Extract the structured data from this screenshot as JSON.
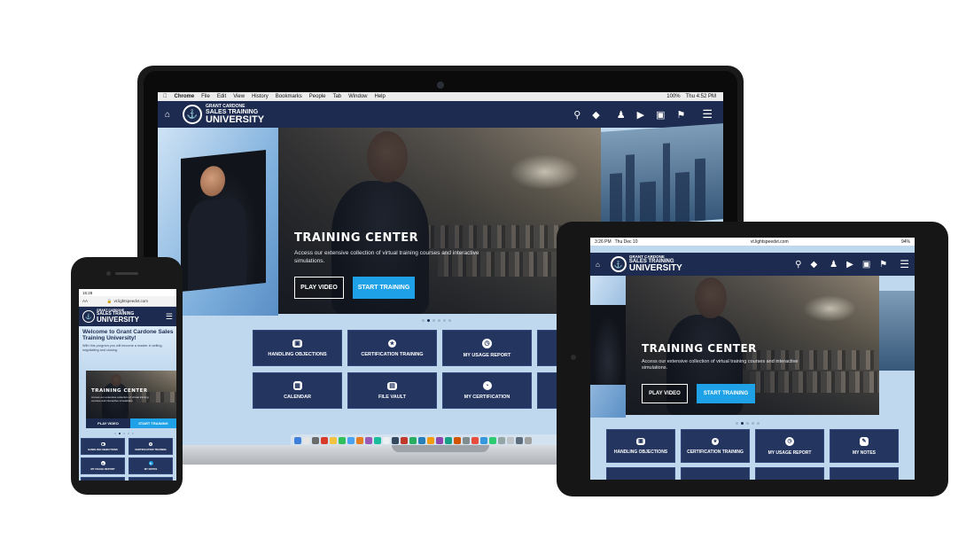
{
  "colors": {
    "navy": "#1c2b4f",
    "tile": "#24355f",
    "accent_blue": "#1ea1e6"
  },
  "laptop": {
    "menubar": {
      "items": [
        "Chrome",
        "File",
        "Edit",
        "View",
        "History",
        "Bookmarks",
        "People",
        "Tab",
        "Window",
        "Help"
      ],
      "battery": "100%",
      "clock": "Thu 4:52 PM"
    },
    "logo": {
      "line1": "Grant Cardone",
      "line2": "Sales Training",
      "line3": "University"
    },
    "nav_icons": [
      "home-icon",
      "search-icon",
      "diamond-icon",
      "user-icon",
      "megaphone-icon",
      "briefcase-icon",
      "flag-icon",
      "menu-icon"
    ],
    "hero": {
      "title": "TRAINING CENTER",
      "description": "Access our extensive collection of virtual training courses and interactive simulations.",
      "play_label": "PLAY VIDEO",
      "start_label": "START TRAINING"
    },
    "tiles": [
      {
        "label": "HANDLING OBJECTIONS",
        "icon": "briefcase-icon"
      },
      {
        "label": "CERTIFICATION TRAINING",
        "icon": "award-icon"
      },
      {
        "label": "MY USAGE REPORT",
        "icon": "gauge-icon"
      },
      {
        "label": "CALENDAR",
        "icon": "calendar-icon"
      },
      {
        "label": "FILE VAULT",
        "icon": "vault-icon"
      },
      {
        "label": "MY CERTIFICATION",
        "icon": "pie-chart-icon"
      }
    ]
  },
  "tablet": {
    "status": {
      "time": "3:26 PM",
      "date": "Thu Dec 10",
      "url": "vt.lightspeedvt.com",
      "battery": "94%"
    },
    "hero": {
      "title": "TRAINING CENTER",
      "description": "Access our extensive collection of virtual training courses and interactive simulations.",
      "play_label": "PLAY VIDEO",
      "start_label": "START TRAINING"
    },
    "tiles": [
      {
        "label": "HANDLING OBJECTIONS",
        "icon": "briefcase-icon"
      },
      {
        "label": "CERTIFICATION TRAINING",
        "icon": "award-icon"
      },
      {
        "label": "MY USAGE REPORT",
        "icon": "gauge-icon"
      },
      {
        "label": "MY NOTES",
        "icon": "edit-icon"
      }
    ]
  },
  "phone": {
    "status": {
      "time": "15:28"
    },
    "url": "vt.lightspeedvt.com",
    "url_left": "AA",
    "welcome": "Welcome to Grant Cardone Sales Training University!",
    "welcome_desc": "With this program you will become a master in selling, negotiating and closing.",
    "hero": {
      "title": "TRAINING CENTER",
      "description": "Access our extensive collection of virtual training courses and interactive simulations.",
      "play_label": "PLAY VIDEO",
      "start_label": "START TRAINING"
    },
    "tiles": [
      {
        "label": "HANDLING OBJECTIONS",
        "icon": "briefcase-icon"
      },
      {
        "label": "CERTIFICATION TRAINING",
        "icon": "award-icon"
      },
      {
        "label": "MY USAGE REPORT",
        "icon": "gauge-icon"
      },
      {
        "label": "MY NOTES",
        "icon": "edit-icon"
      }
    ]
  }
}
